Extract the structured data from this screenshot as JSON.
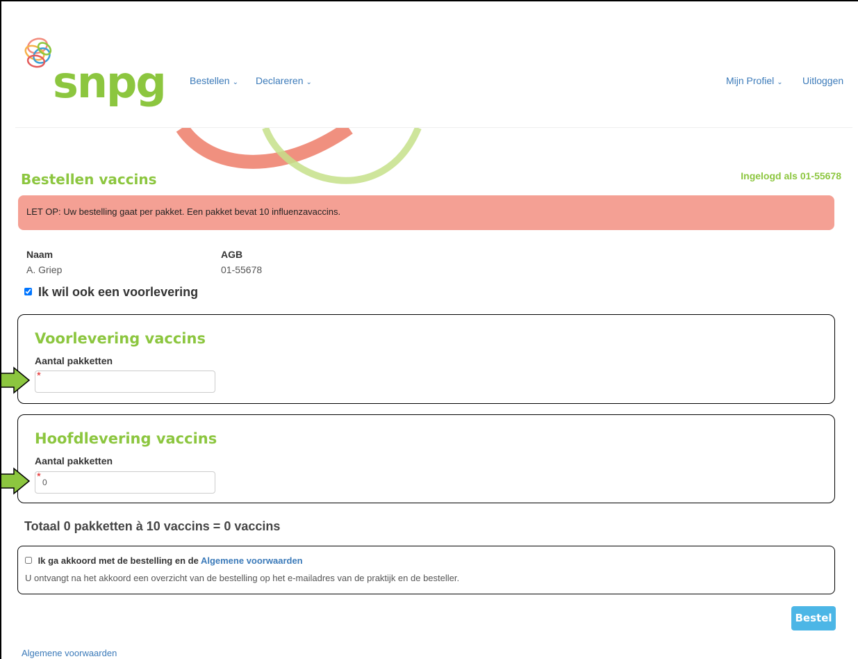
{
  "header": {
    "logo_text": "snpg",
    "nav_left": [
      {
        "label": "Bestellen",
        "icon": "chevron-down-icon"
      },
      {
        "label": "Declareren",
        "icon": "chevron-down-icon"
      }
    ],
    "nav_right": [
      {
        "label": "Mijn Profiel",
        "icon": "chevron-down-icon"
      },
      {
        "label": "Uitloggen"
      }
    ]
  },
  "page": {
    "title": "Bestellen vaccins",
    "logged_in": "Ingelogd als 01-55678"
  },
  "alert": {
    "text": "LET OP: Uw bestelling gaat per pakket. Een pakket bevat 10 influenzavaccins."
  },
  "info": {
    "naam_label": "Naam",
    "naam_value": "A. Griep",
    "agb_label": "AGB",
    "agb_value": "01-55678"
  },
  "voorlevering_checkbox": {
    "label": "Ik wil ook een voorlevering",
    "checked": true
  },
  "voorlevering": {
    "title": "Voorlevering vaccins",
    "field_label": "Aantal pakketten",
    "required_mark": "*",
    "value": ""
  },
  "hoofdlevering": {
    "title": "Hoofdlevering vaccins",
    "field_label": "Aantal pakketten",
    "required_mark": "*",
    "value": "0"
  },
  "totaal": "Totaal 0 pakketten à 10 vaccins = 0 vaccins",
  "agreement": {
    "label": "Ik ga akkoord met de bestelling en de",
    "link": "Algemene voorwaarden",
    "note": "U ontvangt na het akkoord een overzicht van de bestelling op het e-mailadres van de praktijk en de besteller.",
    "checked": false
  },
  "submit_label": "Bestel",
  "footer_link": "Algemene voorwaarden",
  "colors": {
    "brand_green": "#8cc63f",
    "link_blue": "#3b7ab9",
    "alert_bg": "#f4a094",
    "button_blue": "#4cb6e6",
    "arrow_green": "#8cc63f"
  }
}
